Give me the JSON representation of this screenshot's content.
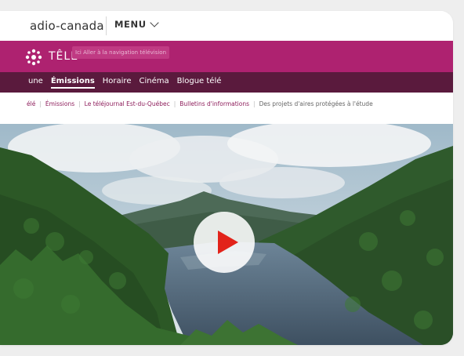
{
  "header": {
    "brand": "adio-canada",
    "menu_label": "MENU"
  },
  "tele_bar": {
    "label": "TÊLÊ",
    "skip_link": "Ici Aller à la navigation télévision",
    "color": "#ae2270"
  },
  "nav": {
    "items": [
      {
        "label": "une",
        "active": false
      },
      {
        "label": "Émissions",
        "active": true
      },
      {
        "label": "Horaire",
        "active": false
      },
      {
        "label": "Cinéma",
        "active": false
      },
      {
        "label": "Blogue télé",
        "active": false
      }
    ],
    "color": "#5a1a3d"
  },
  "breadcrumb": [
    {
      "label": "élé",
      "current": false
    },
    {
      "label": "Émissions",
      "current": false
    },
    {
      "label": "Le téléjournal Est-du-Québec",
      "current": false
    },
    {
      "label": "Bulletins d'informations",
      "current": false
    },
    {
      "label": "Des projets d'aires protégées à l'étude",
      "current": true
    }
  ],
  "video": {
    "play_icon": "play-icon",
    "play_color": "#e2231a"
  }
}
